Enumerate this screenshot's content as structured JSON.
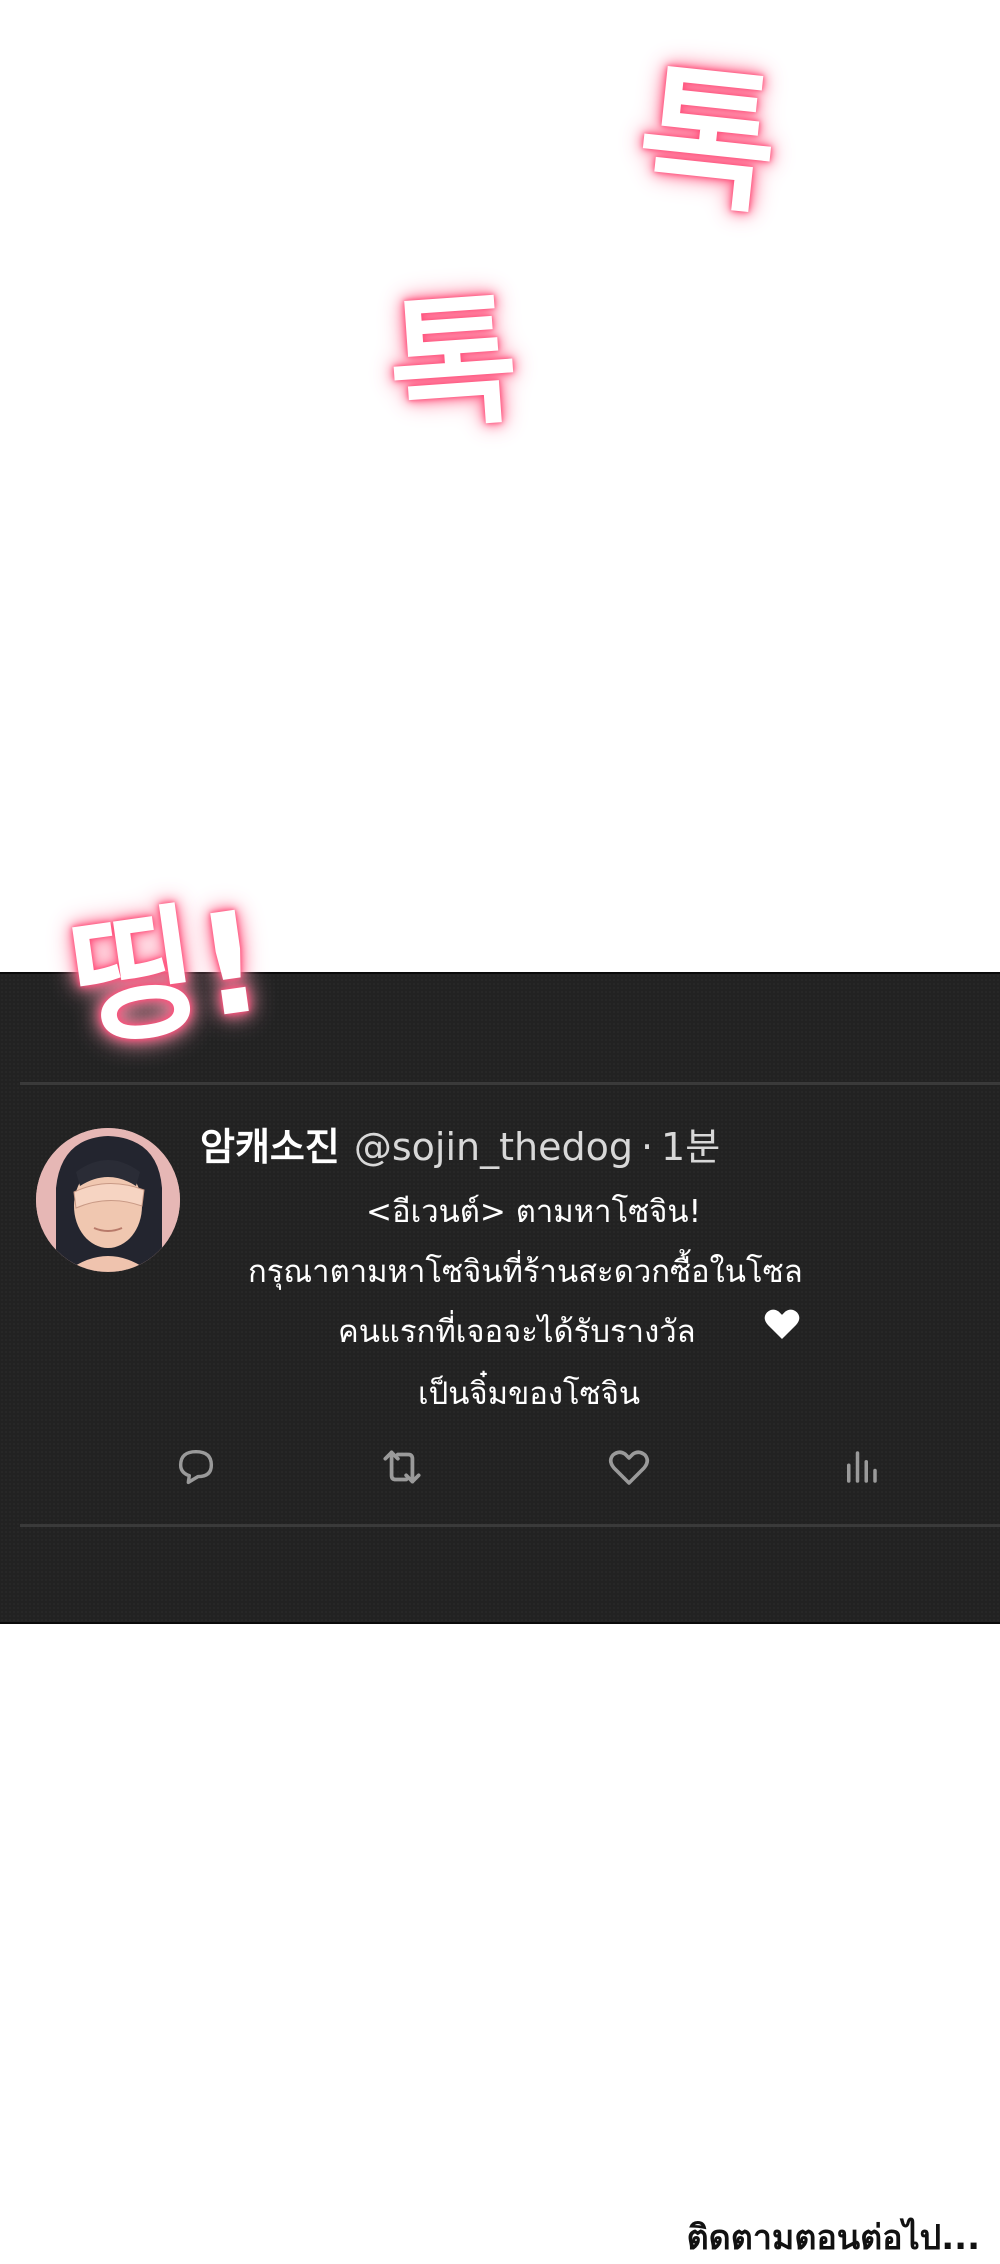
{
  "sfx": {
    "tok_1": "톡",
    "tok_2": "톡",
    "ting": "띵!"
  },
  "tweet": {
    "display_name": "암캐소진",
    "handle": "@sojin_thedog",
    "separator": "·",
    "time": "1분",
    "lines": [
      "<อีเวนต์> ตามหาโซจิน!",
      "กรุณาตามหาโซจินที่ร้านสะดวกซื้อในโซล",
      "คนแรกที่เจอจะได้รับรางวัล",
      "เป็นจิ๋มของโซจิน"
    ],
    "heart_emoji": "♥"
  },
  "actions": [
    "reply-icon",
    "retweet-icon",
    "like-icon",
    "views-icon"
  ],
  "footer": {
    "text": "ติดตามตอนต่อไป..."
  },
  "colors": {
    "panel_bg": "#222222",
    "sfx_glow": "#ff4f7a",
    "icon_gray": "#9a9a9a"
  }
}
